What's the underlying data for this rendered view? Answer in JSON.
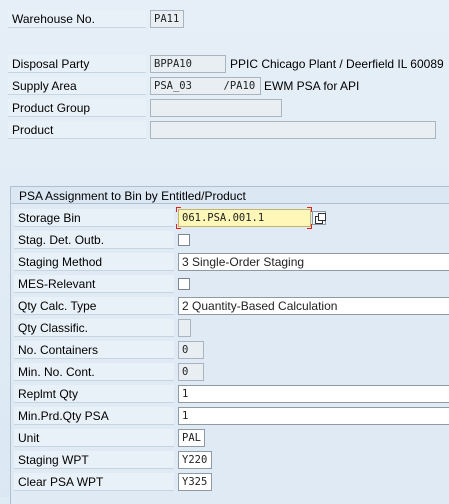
{
  "header": {
    "warehouse_no_label": "Warehouse No.",
    "warehouse_no_value": "PA11",
    "disposal_party_label": "Disposal Party",
    "disposal_party_value": "BPPA10",
    "disposal_party_desc": "PPIC Chicago Plant / Deerfield IL 60089",
    "supply_area_label": "Supply Area",
    "supply_area_value": "PSA_03     /PA10",
    "supply_area_desc": "EWM PSA for API",
    "product_group_label": "Product Group",
    "product_group_value": "",
    "product_label": "Product",
    "product_value": ""
  },
  "section": {
    "title": "PSA Assignment to Bin by Entitled/Product",
    "storage_bin_label": "Storage Bin",
    "storage_bin_value": "061.PSA.001.1",
    "stag_det_outb_label": "Stag. Det. Outb.",
    "staging_method_label": "Staging Method",
    "staging_method_value": "3 Single-Order Staging",
    "mes_relevant_label": "MES-Relevant",
    "qty_calc_type_label": "Qty Calc. Type",
    "qty_calc_type_value": "2 Quantity-Based Calculation",
    "qty_classific_label": "Qty Classific.",
    "qty_classific_value": "",
    "no_containers_label": "No. Containers",
    "no_containers_value": "0",
    "min_no_cont_label": "Min. No. Cont.",
    "min_no_cont_value": "0",
    "replmt_qty_label": "Replmt Qty",
    "replmt_qty_value": "1",
    "min_prd_qty_label": "Min.Prd.Qty PSA",
    "min_prd_qty_value": "1",
    "unit_label": "Unit",
    "unit_value": "PAL",
    "staging_wpt_label": "Staging WPT",
    "staging_wpt_value": "Y220",
    "clear_psa_wpt_label": "Clear PSA WPT",
    "clear_psa_wpt_value": "Y325"
  },
  "colors": {
    "background": "#dfebf5",
    "mandatory_field": "#fff7b8",
    "focus_bracket": "#dd2222"
  },
  "icons": {
    "value_help": "value-help-icon"
  }
}
